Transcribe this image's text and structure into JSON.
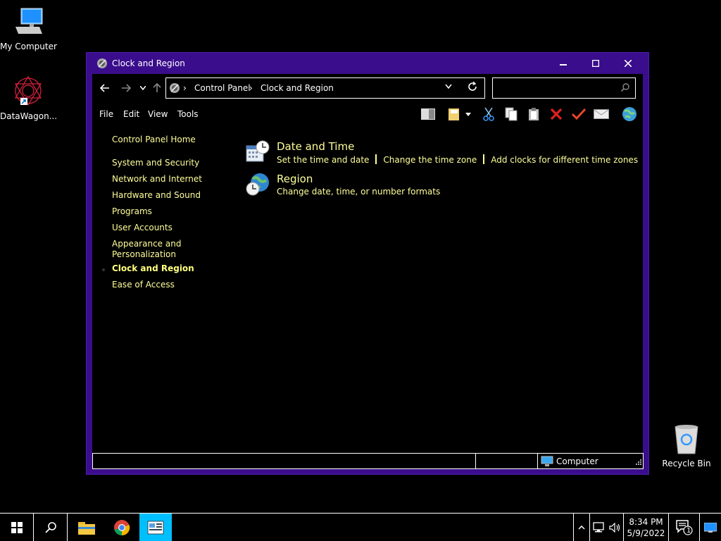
{
  "desktop": {
    "my_computer": "My Computer",
    "datawagon": "DataWagon...",
    "recycle_bin": "Recycle Bin"
  },
  "window": {
    "title": "Clock and Region",
    "controls": {
      "minimize": "minimize",
      "maximize": "maximize",
      "close": "close"
    }
  },
  "address": {
    "crumbs": [
      "Control Panel",
      "Clock and Region"
    ],
    "search_placeholder": ""
  },
  "menu": [
    "File",
    "Edit",
    "View",
    "Tools"
  ],
  "left_nav": {
    "home": "Control Panel Home",
    "items": [
      "System and Security",
      "Network and Internet",
      "Hardware and Sound",
      "Programs",
      "User Accounts",
      "Appearance and",
      "Personalization",
      "Clock and Region",
      "Ease of Access"
    ]
  },
  "categories": [
    {
      "title": "Date and Time",
      "links": [
        "Set the time and date",
        "Change the time zone",
        "Add clocks for different time zones"
      ]
    },
    {
      "title": "Region",
      "links": [
        "Change date, time, or number formats"
      ]
    }
  ],
  "status": {
    "location": "Computer"
  },
  "taskbar": {
    "time": "8:34 PM",
    "date": "5/9/2022",
    "notification_count": "1"
  },
  "colors": {
    "accent_purple": "#3a0d8c",
    "link_yellow": "#ffff99",
    "taskbar_active": "#00bfff"
  }
}
